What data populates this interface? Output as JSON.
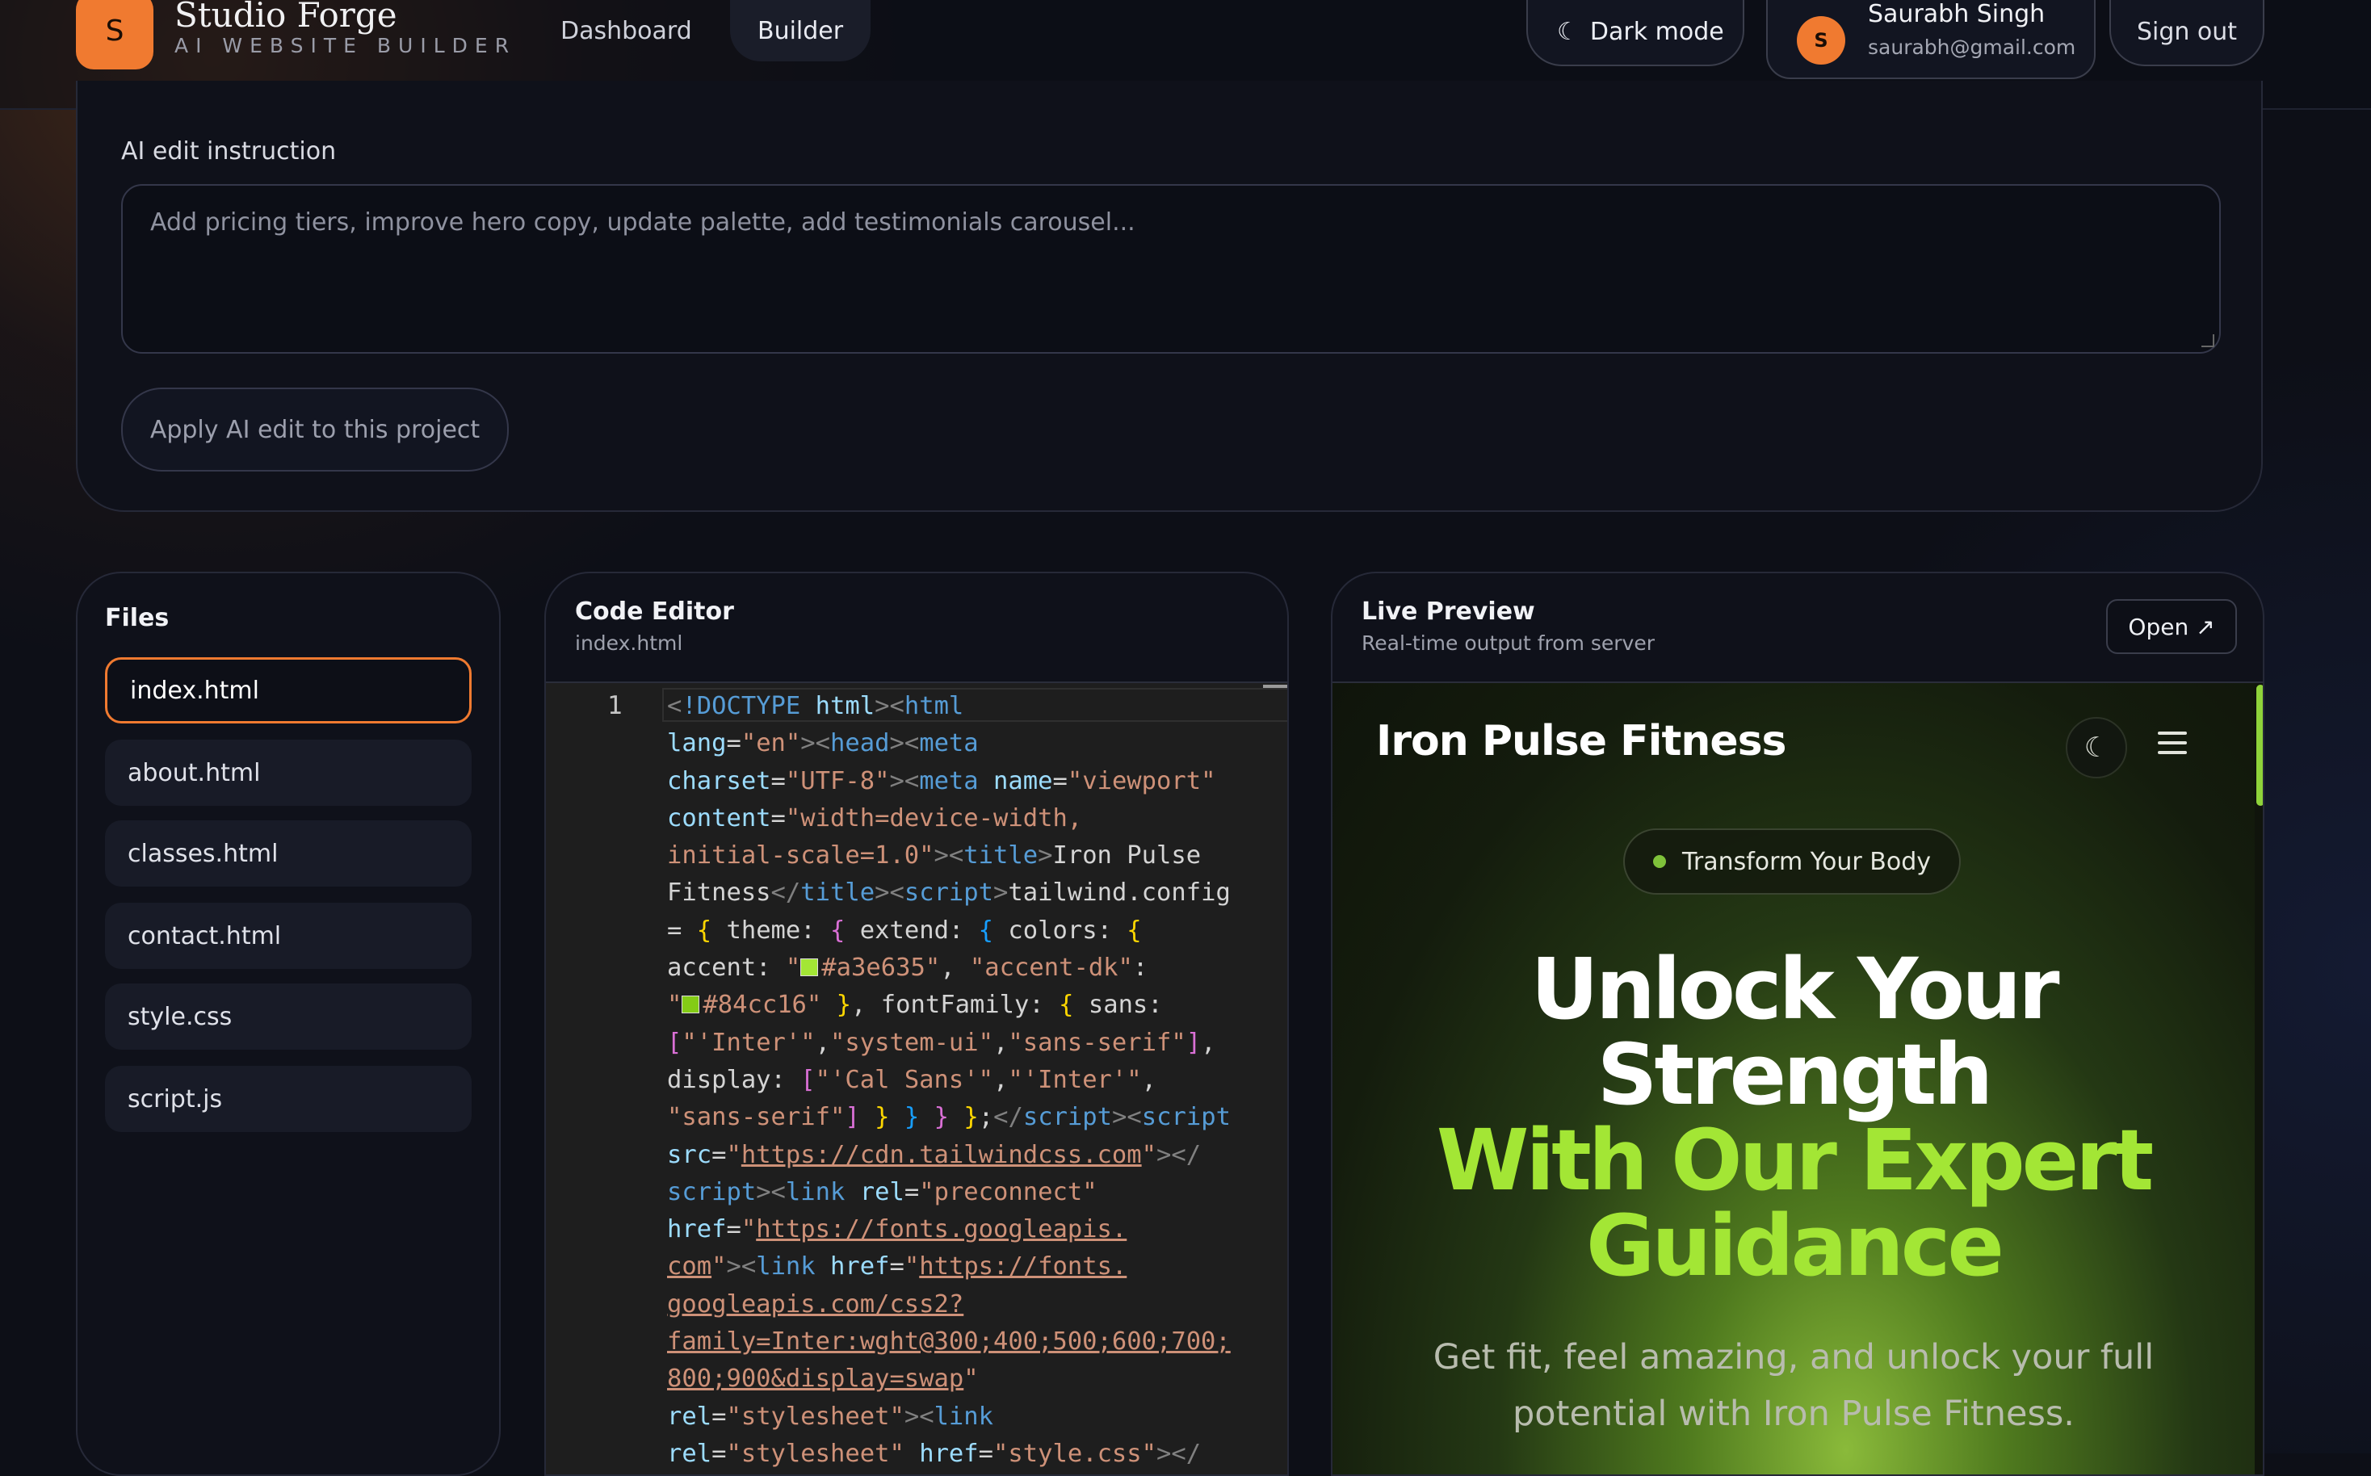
{
  "header": {
    "logo_letter": "S",
    "brand_name": "Studio Forge",
    "brand_sub": "AI WEBSITE BUILDER",
    "nav": [
      {
        "label": "Dashboard"
      },
      {
        "label": "Builder"
      }
    ],
    "theme_toggle_label": "Dark mode",
    "theme_icon": "moon-icon",
    "user": {
      "initial": "S",
      "name": "Saurabh Singh",
      "email": "saurabh@gmail.com"
    },
    "signout_label": "Sign out"
  },
  "ai_edit": {
    "label": "AI edit instruction",
    "value": "",
    "placeholder": "Add pricing tiers, improve hero copy, update palette, add testimonials carousel...",
    "apply_label": "Apply AI edit to this project"
  },
  "files": {
    "title": "Files",
    "items": [
      {
        "name": "index.html",
        "active": true
      },
      {
        "name": "about.html"
      },
      {
        "name": "classes.html"
      },
      {
        "name": "contact.html"
      },
      {
        "name": "style.css"
      },
      {
        "name": "script.js"
      }
    ]
  },
  "editor": {
    "title": "Code Editor",
    "filename": "index.html",
    "line_number": "1",
    "colors": {
      "accent": "#a3e635",
      "accent_dk": "#84cc16"
    }
  },
  "preview": {
    "title": "Live Preview",
    "subtitle": "Real-time output from server",
    "open_label": "Open ↗",
    "site": {
      "brand": "Iron Pulse Fitness",
      "badge": "Transform Your Body",
      "headline_white_1": "Unlock Your",
      "headline_white_2": "Strength",
      "headline_accent_1": "With Our Expert",
      "headline_accent_2": "Guidance",
      "description": "Get fit, feel amazing, and unlock your full potential with Iron Pulse Fitness.",
      "accent_color": "#a3e635"
    }
  },
  "colors": {
    "brand_orange": "#f07a30",
    "background": "#0d0f17"
  }
}
